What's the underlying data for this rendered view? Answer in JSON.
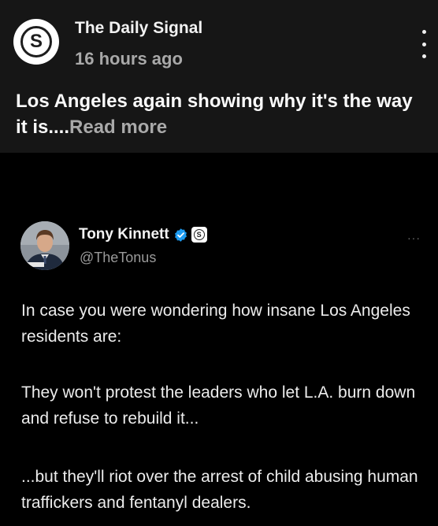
{
  "post": {
    "publisher": "The Daily Signal",
    "time": "16 hours ago",
    "headline": "Los Angeles again showing why it's the way it is....",
    "read_more": "Read more"
  },
  "tweet": {
    "name": "Tony Kinnett",
    "handle": "@TheTonus",
    "more": "···",
    "paragraphs": [
      "In case you were wondering how insane Los Angeles residents are:",
      "They won't protest the leaders who let L.A. burn down and refuse to rebuild it...",
      "...but they'll riot over the arrest of child abusing human traffickers and fentanyl dealers."
    ]
  },
  "colors": {
    "post_bg": "#161616",
    "page_bg": "#000000",
    "verified": "#1d9bf0"
  },
  "icons": {
    "publisher_logo": "daily-signal-logo",
    "options": "kebab-menu-icon",
    "verified": "verified-check-icon",
    "org_badge": "daily-signal-badge"
  }
}
